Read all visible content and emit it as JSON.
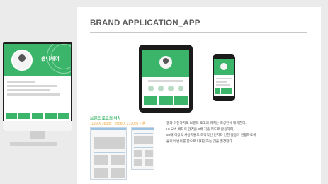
{
  "header": {
    "title": "BRAND APPLICATION_APP"
  },
  "imac": {
    "hero_title": "옴니케어",
    "logo_glyph": ""
  },
  "logo_position": {
    "title": "브랜드 로고의 위치",
    "sizes": "1129 X 263px | 2668 X 2730px ~ 등"
  },
  "description": {
    "lines": [
      "웹과 마찬가지로 브랜드 로고의 위치는 최상단에 배치한다.",
      "UI 요소 배치의 간격은 8배 기준 적도로 활용하며,",
      "50대 이상의 사용자들도 즉각적인 인지와 인한 활동이 원활하도록",
      "클릭의 범위를 한으로 디자인하는 것을 권장한다."
    ]
  },
  "colors": {
    "brand_green": "#3bb56a",
    "accent_orange": "#f1a33a",
    "wire_blue": "#9bc1e3"
  }
}
